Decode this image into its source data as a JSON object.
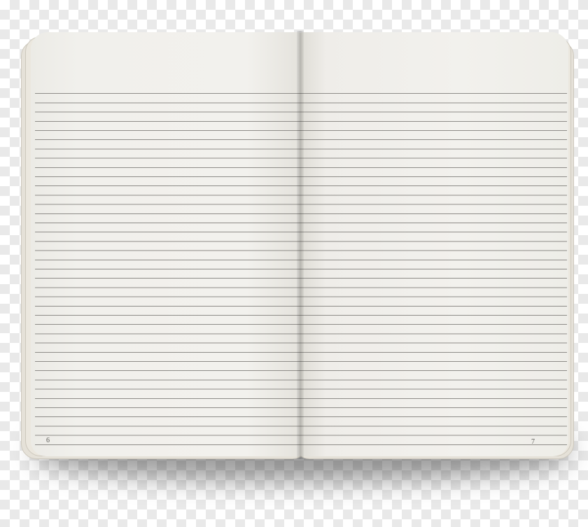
{
  "notebook": {
    "left_page_number": "6",
    "right_page_number": "7"
  }
}
